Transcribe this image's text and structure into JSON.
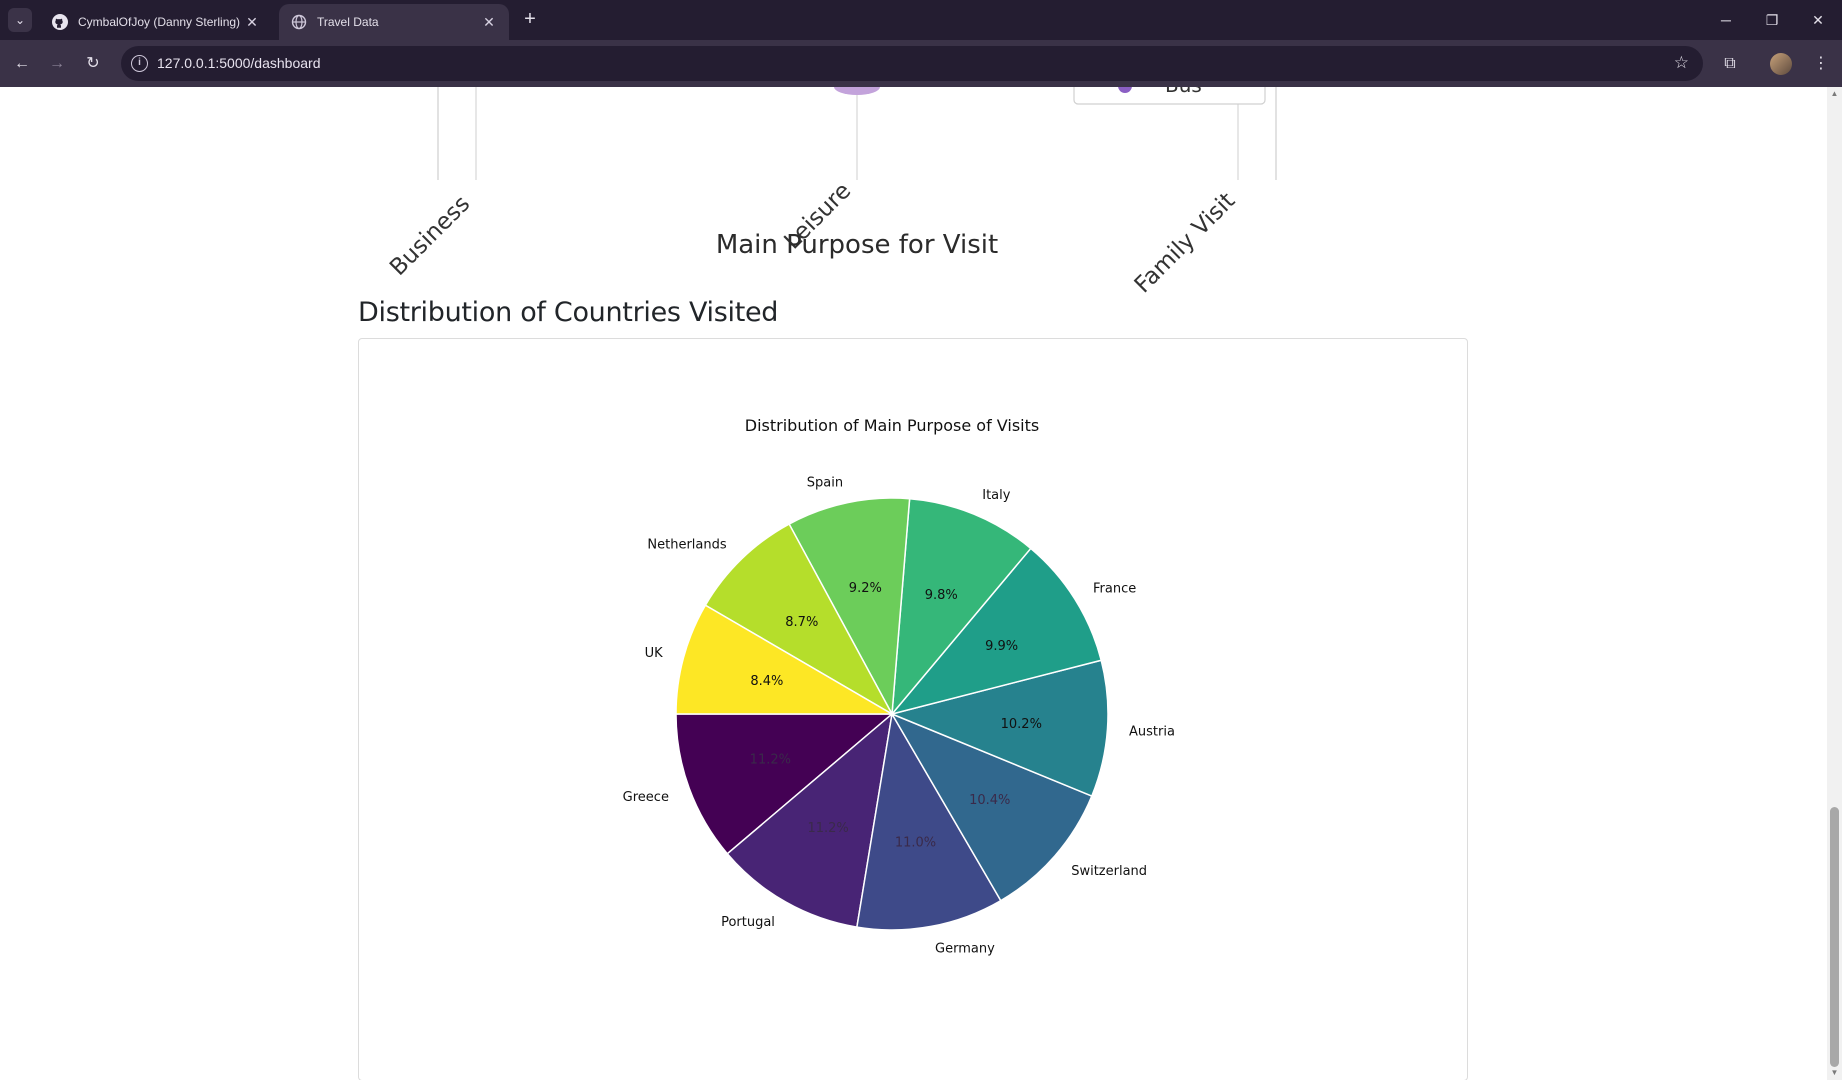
{
  "browser": {
    "tabs": [
      {
        "title": "CymbalOfJoy (Danny Sterling)",
        "active": false
      },
      {
        "title": "Travel Data",
        "active": true
      }
    ],
    "url": "127.0.0.1:5000/dashboard",
    "window_controls": {
      "minimize": "─",
      "restore": "❐",
      "close": "✕"
    }
  },
  "page": {
    "section_title": "Distribution of Countries Visited"
  },
  "chart_data": [
    {
      "type": "bar",
      "categories": [
        "Business",
        "Leisure",
        "Family Visit"
      ],
      "xlabel": "Main Purpose for Visit",
      "legend_visible_entry": "Bus",
      "legend_placement": "top-right"
    },
    {
      "type": "pie",
      "title": "Distribution of Main Purpose of Visits",
      "slices": [
        {
          "label": "Greece",
          "value": 11.2,
          "pct_label": "11.2%",
          "color": "#440154"
        },
        {
          "label": "Portugal",
          "value": 11.2,
          "pct_label": "11.2%",
          "color": "#482475"
        },
        {
          "label": "Germany",
          "value": 11.0,
          "pct_label": "11.0%",
          "color": "#3e4a89"
        },
        {
          "label": "Switzerland",
          "value": 10.4,
          "pct_label": "10.4%",
          "color": "#31688e"
        },
        {
          "label": "Austria",
          "value": 10.2,
          "pct_label": "10.2%",
          "color": "#26828e"
        },
        {
          "label": "France",
          "value": 9.9,
          "pct_label": "9.9%",
          "color": "#1f9e89"
        },
        {
          "label": "Italy",
          "value": 9.8,
          "pct_label": "9.8%",
          "color": "#35b779"
        },
        {
          "label": "Spain",
          "value": 9.2,
          "pct_label": "9.2%",
          "color": "#6ccd5a"
        },
        {
          "label": "Netherlands",
          "value": 8.7,
          "pct_label": "8.7%",
          "color": "#b5de2b"
        },
        {
          "label": "UK",
          "value": 8.4,
          "pct_label": "8.4%",
          "color": "#fde725"
        }
      ]
    }
  ]
}
